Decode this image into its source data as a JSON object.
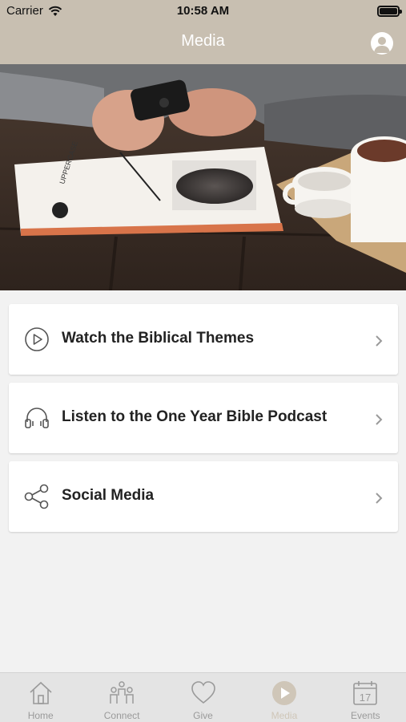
{
  "status_bar": {
    "carrier": "Carrier",
    "time": "10:58 AM"
  },
  "header": {
    "title": "Media"
  },
  "menu": [
    {
      "label": "Watch the Biblical Themes",
      "icon": "play-circle-icon"
    },
    {
      "label": "Listen to the One Year Bible Podcast",
      "icon": "headphones-icon"
    },
    {
      "label": "Social Media",
      "icon": "share-icon"
    }
  ],
  "tabs": [
    {
      "label": "Home",
      "icon": "home-icon"
    },
    {
      "label": "Connect",
      "icon": "people-icon"
    },
    {
      "label": "Give",
      "icon": "heart-icon"
    },
    {
      "label": "Media",
      "icon": "play-icon",
      "active": true
    },
    {
      "label": "Events",
      "icon": "calendar-icon",
      "day": "17"
    }
  ],
  "colors": {
    "header": "#c8bfb1",
    "active_tab": "#cfc6b8",
    "inactive_tab": "#9a9a9a"
  }
}
